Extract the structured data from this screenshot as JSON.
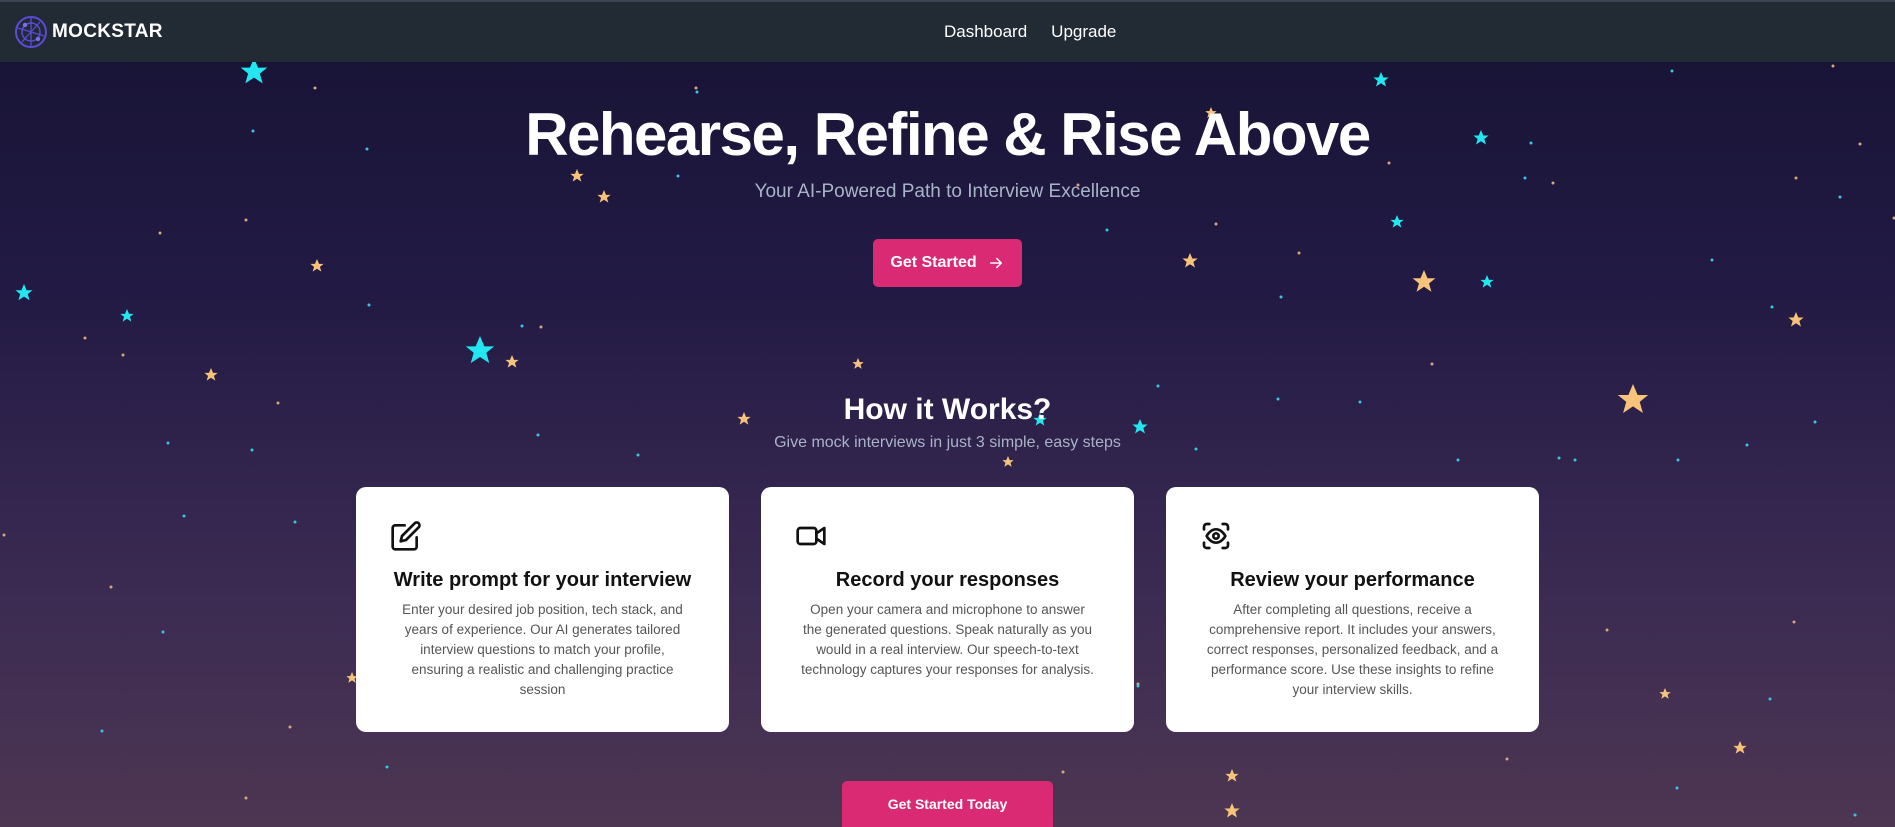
{
  "navbar": {
    "logo_text": "MOCKSTAR",
    "links": [
      {
        "label": "Dashboard"
      },
      {
        "label": "Upgrade"
      }
    ]
  },
  "hero": {
    "title": "Rehearse, Refine & Rise Above",
    "subtitle": "Your AI-Powered Path to Interview Excellence",
    "cta_label": "Get Started",
    "cta_icon": "arrow-right-icon"
  },
  "how_it_works": {
    "title": "How it Works?",
    "subtitle": "Give mock interviews in just 3 simple, easy steps",
    "cards": [
      {
        "icon": "edit-icon",
        "title": "Write prompt for your interview",
        "text": "Enter your desired job position, tech stack, and years of experience. Our AI generates tailored interview questions to match your profile, ensuring a realistic and challenging practice session"
      },
      {
        "icon": "video-camera-icon",
        "title": "Record your responses",
        "text": "Open your camera and microphone to answer the generated questions. Speak naturally as you would in a real interview. Our speech-to-text technology captures your responses for analysis."
      },
      {
        "icon": "eye-scan-icon",
        "title": "Review your performance",
        "text": "After completing all questions, receive a comprehensive report. It includes your answers, correct responses, personalized feedback, and a performance score. Use these insights to refine your interview skills."
      }
    ],
    "bottom_cta_label": "Get Started Today"
  },
  "colors": {
    "accent": "#d92a73",
    "nav_bg": "#222a33",
    "star_cyan": "#22e6f0",
    "star_yellow": "#f7c37a"
  }
}
